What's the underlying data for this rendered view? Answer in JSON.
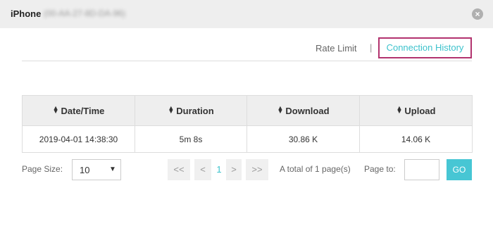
{
  "header": {
    "title": "iPhone",
    "mac": "(00-AA-27-8D-DA-96)",
    "close_icon": "close-icon"
  },
  "tabs": {
    "rate_limit": "Rate Limit",
    "separator": "|",
    "connection_history": "Connection History",
    "active": "connection_history",
    "highlight_color": "#b2336e",
    "link_color": "#3cc2cc"
  },
  "table": {
    "columns": [
      "Date/Time",
      "Duration",
      "Download",
      "Upload"
    ],
    "rows": [
      [
        "2019-04-01 14:38:30",
        "5m 8s",
        "30.86 K",
        "14.06 K"
      ]
    ]
  },
  "pagination": {
    "page_size_label": "Page Size:",
    "page_size_value": "10",
    "first": "<<",
    "prev": "<",
    "current_page": "1",
    "next": ">",
    "last": ">>",
    "total_text": "A total of 1 page(s)",
    "page_to_label": "Page to:",
    "page_to_value": "",
    "go_label": "GO",
    "go_color": "#47c6d4"
  }
}
